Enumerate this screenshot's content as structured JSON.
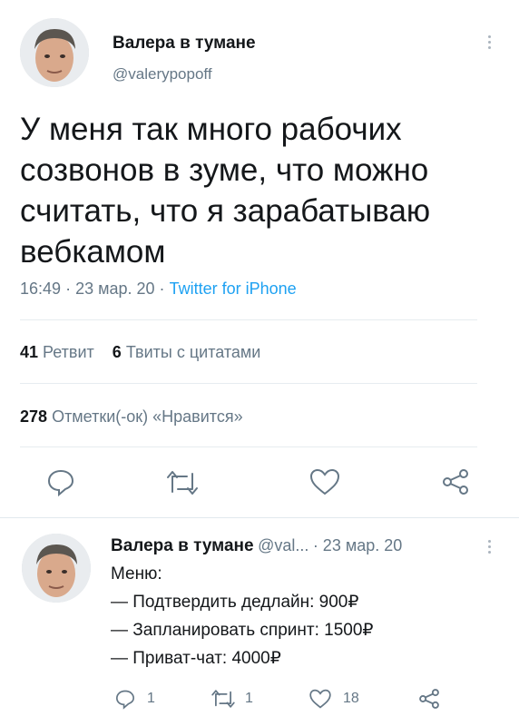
{
  "tweet": {
    "author_name": "Валера в тумане",
    "handle": "@valerypopoff",
    "text_lines": [
      "У меня так много рабочих",
      "созвонов в зуме, что можно",
      "считать, что я зарабатываю",
      "вебкамом"
    ],
    "time": "16:49",
    "date": "23 мар. 20",
    "separator": "·",
    "source": "Twitter for iPhone",
    "retweets_count": "41",
    "retweets_label": "Ретвит",
    "quotes_count": "6",
    "quotes_label": "Твиты с цитатами",
    "likes_count": "278",
    "likes_label": "Отметки(-ок) «Нравится»"
  },
  "actions": {
    "icons": [
      "reply-icon",
      "retweet-icon",
      "like-icon",
      "share-icon"
    ]
  },
  "reply": {
    "author_name": "Валера в тумане",
    "handle": "@val...",
    "date": "· 23 мар. 20",
    "lines": [
      "Меню:",
      "— Подтвердить дедлайн: 900₽",
      "— Запланировать спринт: 1500₽",
      "— Приват-чат: 4000₽"
    ],
    "reply_count": "1",
    "retweet_count": "1",
    "like_count": "18"
  },
  "colors": {
    "accent": "#1da1f2",
    "muted": "#657786",
    "divider": "#e6ecf0"
  }
}
